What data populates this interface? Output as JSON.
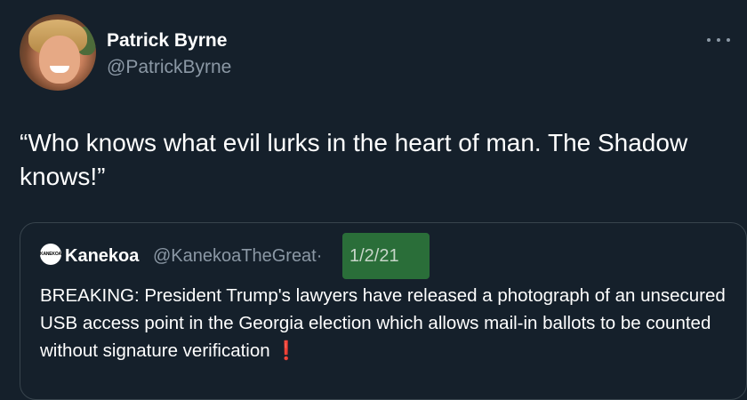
{
  "tweet": {
    "author_name": "Patrick Byrne",
    "author_handle": "@PatrickByrne",
    "text": "“Who knows what evil lurks in the heart of man. The Shadow knows!”",
    "more_icon": "more-horizontal-icon"
  },
  "quoted_tweet": {
    "avatar_text": "KANEKOA",
    "author_name": "Kanekoa",
    "author_handle": "@KanekoaTheGreat",
    "separator": "·",
    "date": "1/2/21",
    "text": "BREAKING: President Trump's lawyers have released a photograph of an unsecured USB access point in the Georgia election which allows mail-in ballots to be counted without signature verification",
    "emoji": "❗",
    "highlight_color": "#2e7d3c"
  },
  "colors": {
    "background": "#15202b",
    "secondary_text": "#8b98a5",
    "border": "#38444d"
  }
}
